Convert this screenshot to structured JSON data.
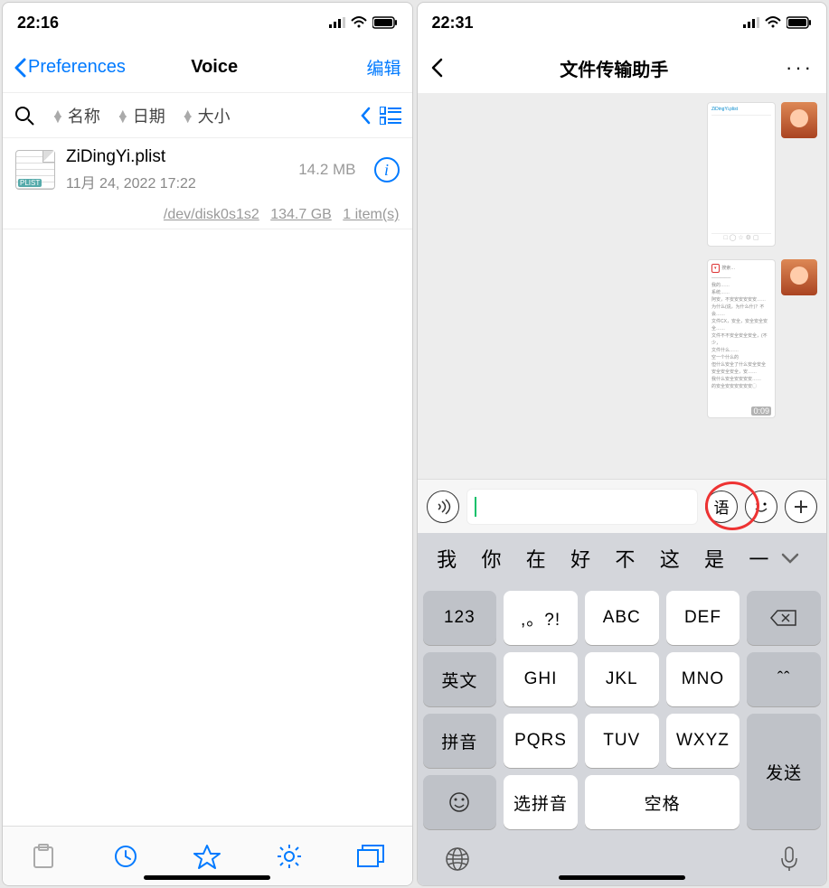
{
  "left": {
    "status_time": "22:16",
    "nav_back": "Preferences",
    "nav_title": "Voice",
    "nav_edit": "编辑",
    "sort_name": "名称",
    "sort_date": "日期",
    "sort_size": "大小",
    "file_name": "ZiDingYi.plist",
    "file_date": "11月 24, 2022 17:22",
    "file_size": "14.2 MB",
    "file_icon_label": "PLIST",
    "footer_disk": "/dev/disk0s1s2",
    "footer_space": "134.7 GB",
    "footer_items": "1 item(s)"
  },
  "right": {
    "status_time": "22:31",
    "chat_title": "文件传输助手",
    "lang_btn": "语",
    "msg2_duration": "0:09",
    "suggestions": [
      "我",
      "你",
      "在",
      "好",
      "不",
      "这",
      "是",
      "一"
    ],
    "keys": {
      "r1c1": "123",
      "r1c2": ",。?!",
      "r1c3": "ABC",
      "r1c4": "DEF",
      "r2c1": "英文",
      "r2c2": "GHI",
      "r2c3": "JKL",
      "r2c4": "MNO",
      "r2c5": "ˆˆ",
      "r3c1": "拼音",
      "r3c2": "PQRS",
      "r3c3": "TUV",
      "r3c4": "WXYZ",
      "send": "发送",
      "select": "选拼音",
      "space": "空格"
    }
  }
}
